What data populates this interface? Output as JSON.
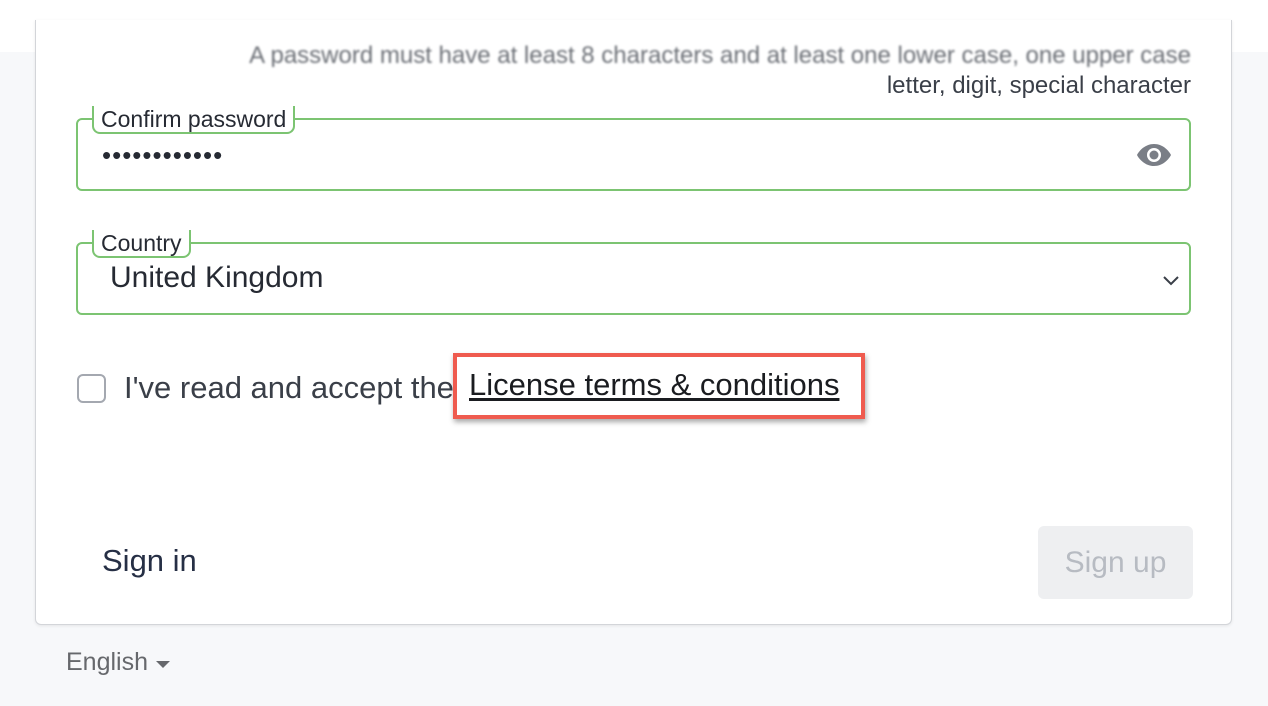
{
  "password_hint": {
    "line1": "A password must have at least 8 characters and at least one lower case, one upper case",
    "line2": "letter, digit, special character"
  },
  "confirm_password": {
    "label": "Confirm password",
    "value": "••••••••••••"
  },
  "country": {
    "label": "Country",
    "value": "United Kingdom"
  },
  "accept": {
    "text": "I've read and accept the",
    "link": "License terms & conditions"
  },
  "actions": {
    "sign_in": "Sign in",
    "sign_up": "Sign up"
  },
  "language": {
    "selected": "English"
  },
  "icons": {
    "password_visibility": "eye-icon",
    "country_dropdown": "chevron-down-icon",
    "language_dropdown": "caret-down-icon"
  },
  "colors": {
    "field_border_valid": "#7cc472",
    "highlight": "#ef5b4f",
    "button_disabled_bg": "#eeeff1"
  }
}
